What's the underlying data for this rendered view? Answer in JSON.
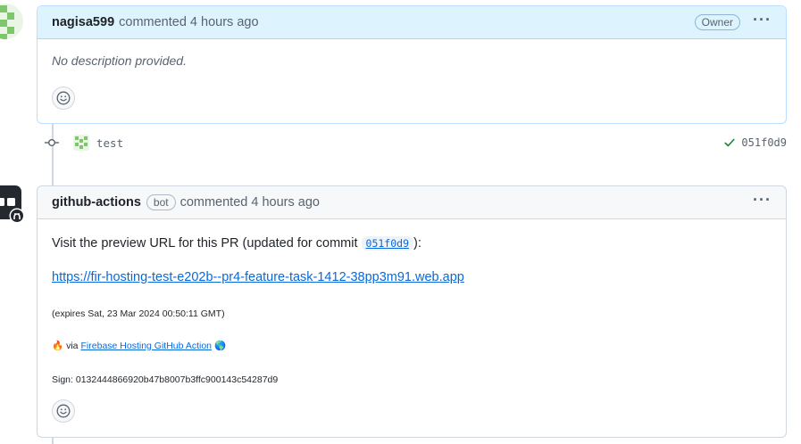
{
  "comment1": {
    "author": "nagisa599",
    "meta": "commented 4 hours ago",
    "badge": "Owner",
    "body": "No description provided."
  },
  "commit": {
    "message": "test",
    "sha": "051f0d9"
  },
  "comment2": {
    "author": "github-actions",
    "badge": "bot",
    "meta": "commented 4 hours ago",
    "line_prefix": "Visit the preview URL for this PR (updated for commit",
    "line_sha": "051f0d9",
    "line_suffix": "):",
    "link": "https://fir-hosting-test-e202b--pr4-feature-task-1412-38pp3m91.web.app",
    "expires": "(expires Sat, 23 Mar 2024 00:50:11 GMT)",
    "via_fire": "🔥",
    "via_text": "via",
    "via_link": "Firebase Hosting GitHub Action",
    "via_globe": "🌎",
    "sign": "Sign: 0132444866920b47b8007b3ffc900143c54287d9"
  },
  "colors": {
    "link": "#0969da",
    "owner_header": "#ddf4ff",
    "check": "#1a7f37"
  },
  "icons": {
    "more": "kebab-horizontal-icon",
    "reaction": "smiley-icon",
    "commit": "git-commit-icon",
    "check": "check-icon"
  }
}
